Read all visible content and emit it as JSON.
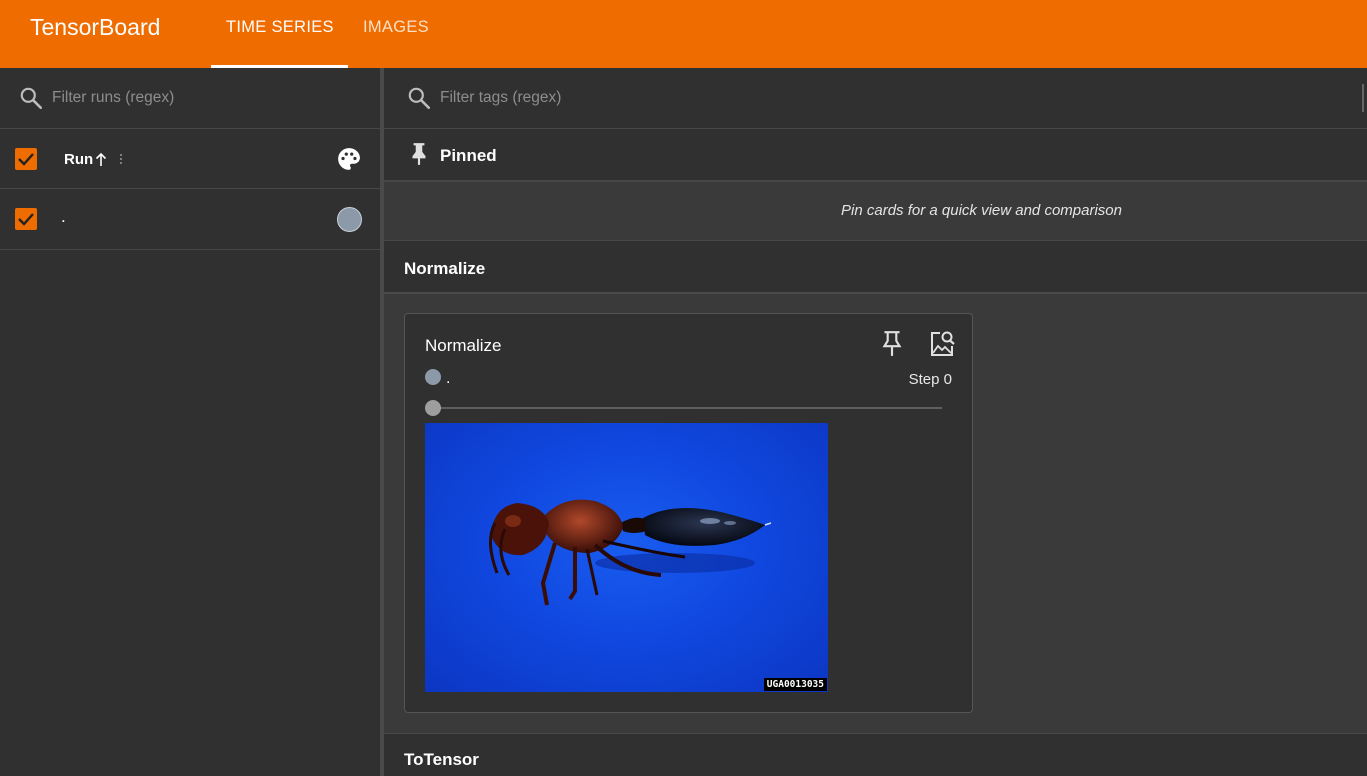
{
  "app": {
    "title": "TensorBoard"
  },
  "tabs": [
    {
      "label": "TIME SERIES",
      "active": true
    },
    {
      "label": "IMAGES",
      "active": false
    }
  ],
  "sidebar": {
    "filter_placeholder": "Filter runs (regex)",
    "header": {
      "column_label": "Run",
      "checked": true
    },
    "runs": [
      {
        "name": ".",
        "checked": true,
        "color": "#8b99a8"
      }
    ]
  },
  "main": {
    "filter_placeholder": "Filter tags (regex)",
    "pinned": {
      "title": "Pinned",
      "empty_message": "Pin cards for a quick view and comparison"
    },
    "sections": [
      {
        "title": "Normalize",
        "cards": [
          {
            "title": "Normalize",
            "run": ".",
            "step_label": "Step 0",
            "image_caption": "UGA0013035"
          }
        ]
      },
      {
        "title": "ToTensor"
      }
    ]
  },
  "colors": {
    "accent": "#ef6c00",
    "run": "#8b99a8"
  }
}
